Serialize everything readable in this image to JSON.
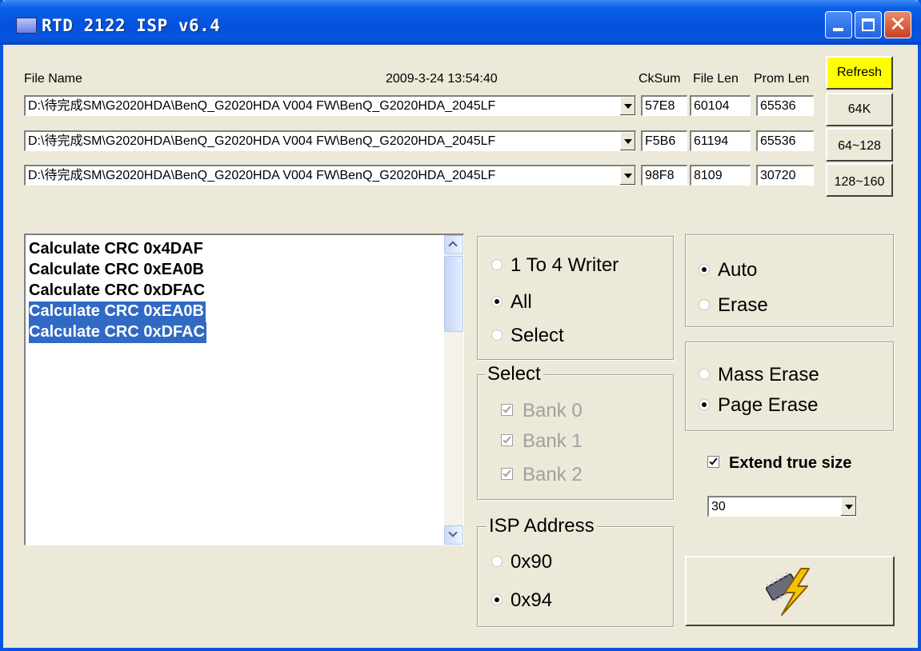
{
  "window": {
    "title": "RTD 2122 ISP v6.4"
  },
  "header": {
    "file_name_label": "File Name",
    "timestamp": "2009-3-24 13:54:40",
    "cksum_label": "CkSum",
    "file_len_label": "File Len",
    "prom_len_label": "Prom Len"
  },
  "files": [
    {
      "path": "D:\\待完成SM\\G2020HDA\\BenQ_G2020HDA V004 FW\\BenQ_G2020HDA_2045LF",
      "cksum": "57E8",
      "file_len": "60104",
      "prom_len": "65536"
    },
    {
      "path": "D:\\待完成SM\\G2020HDA\\BenQ_G2020HDA V004 FW\\BenQ_G2020HDA_2045LF",
      "cksum": "F5B6",
      "file_len": "61194",
      "prom_len": "65536"
    },
    {
      "path": "D:\\待完成SM\\G2020HDA\\BenQ_G2020HDA V004 FW\\BenQ_G2020HDA_2045LF",
      "cksum": "98F8",
      "file_len": "8109",
      "prom_len": "30720"
    }
  ],
  "buttons": {
    "refresh": "Refresh",
    "k64": "64K",
    "k64_128": "64~128",
    "k128_160": "128~160"
  },
  "log": [
    {
      "text": "Calculate CRC  0x4DAF",
      "selected": false
    },
    {
      "text": "Calculate CRC  0xEA0B",
      "selected": false
    },
    {
      "text": "Calculate CRC  0xDFAC",
      "selected": false
    },
    {
      "text": "Calculate CRC  0xEA0B",
      "selected": true
    },
    {
      "text": "Calculate CRC  0xDFAC",
      "selected": true
    }
  ],
  "writer_mode": {
    "options": [
      "1 To 4 Writer",
      "All",
      "Select"
    ],
    "selected": "All"
  },
  "select_group": {
    "caption": "Select",
    "banks": [
      "Bank 0",
      "Bank 1",
      "Bank 2"
    ]
  },
  "isp_address": {
    "caption": "ISP Address",
    "options": [
      "0x90",
      "0x94"
    ],
    "selected": "0x94"
  },
  "mode": {
    "options": [
      "Auto",
      "Erase"
    ],
    "selected": "Auto"
  },
  "erase_type": {
    "options": [
      "Mass Erase",
      "Page Erase"
    ],
    "selected": "Page Erase"
  },
  "extend": {
    "label": "Extend true size",
    "checked": true
  },
  "size_select": {
    "value": "30"
  },
  "icons": {
    "app": "chip-app-icon",
    "run": "lightning-chip-icon"
  }
}
